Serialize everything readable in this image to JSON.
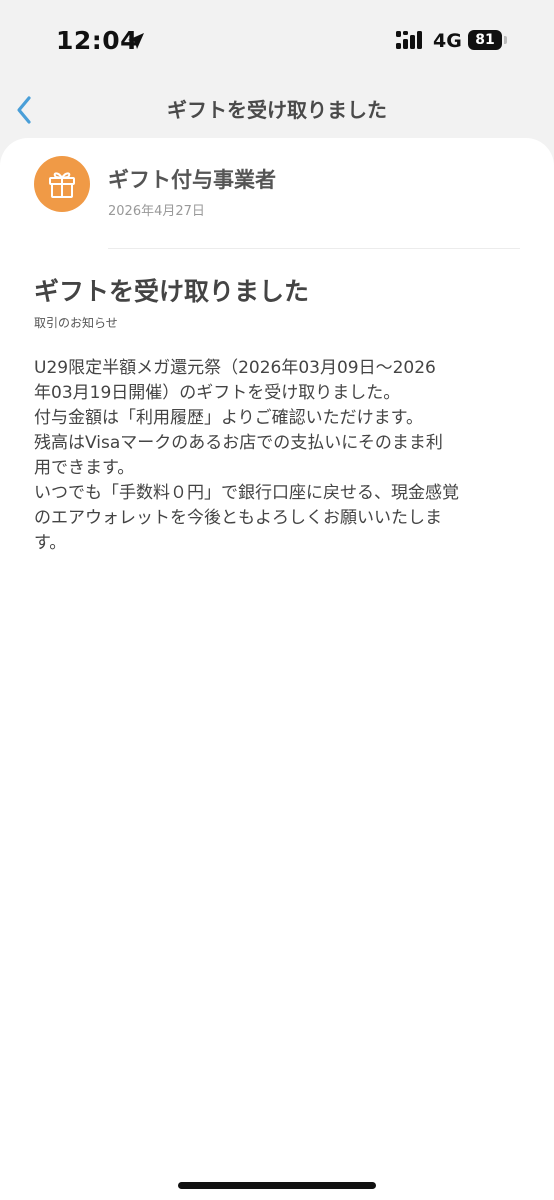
{
  "status_bar": {
    "time": "12:04",
    "network": "4G",
    "battery": "81"
  },
  "nav": {
    "title": "ギフトを受け取りました"
  },
  "sender": {
    "name": "ギフト付与事業者",
    "date": "2026年4月27日"
  },
  "message": {
    "title": "ギフトを受け取りました",
    "category": "取引のお知らせ",
    "body_lines": [
      "U29限定半額メガ還元祭（2026年03月09日〜2026",
      "年03月19日開催）のギフトを受け取りました。",
      "付与金額は「利用履歴」よりご確認いただけます。",
      "残高はVisaマークのあるお店での支払いにそのまま利",
      "用できます。",
      "いつでも「手数料０円」で銀行口座に戻せる、現金感覚",
      "のエアウォレットを今後ともよろしくお願いいたしま",
      "す。"
    ]
  },
  "colors": {
    "accent_orange": "#f09a46",
    "back_arrow": "#4a9fd8"
  }
}
